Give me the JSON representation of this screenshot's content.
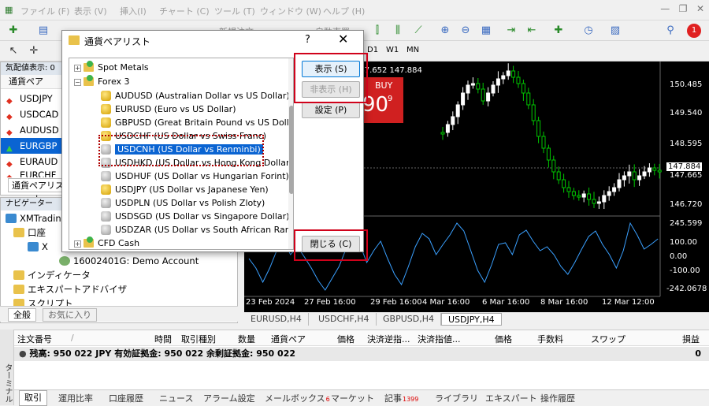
{
  "menu": [
    "ファイル (F)",
    "表示 (V)",
    "挿入(I)",
    "チャート (C)",
    "ツール (T)",
    "ウィンドウ (W)",
    "ヘルプ (H)"
  ],
  "toolbar": {
    "new_order": "新規注文",
    "auto_trade": "自動売買"
  },
  "timeframes": [
    "D1",
    "W1",
    "MN"
  ],
  "quote_line": "147.652 147.884",
  "buy": {
    "label": "BUY",
    "price": "90",
    "sup": "9"
  },
  "market_watch": {
    "header": "気配値表示: 0",
    "column": "通貨ペア",
    "tab": "通貨ペアリスト",
    "rows": [
      {
        "symbol": "USDJPY",
        "dir": "down"
      },
      {
        "symbol": "USDCAD",
        "dir": "down"
      },
      {
        "symbol": "AUDUSD",
        "dir": "down"
      },
      {
        "symbol": "EURGBP",
        "dir": "up"
      },
      {
        "symbol": "EURAUD",
        "dir": "down"
      },
      {
        "symbol": "EURCHF",
        "dir": "down"
      }
    ]
  },
  "navigator": {
    "header": "ナビゲーター",
    "root": "XMTradin",
    "account_folder": "口座",
    "account_sub": "X",
    "demo_account": "16002401G: Demo Account",
    "items": [
      "インディケータ",
      "エキスパートアドバイザ",
      "スクリプト"
    ],
    "tabs": [
      "全般",
      "お気に入り"
    ]
  },
  "dialog": {
    "title": "通貨ペアリスト",
    "help": "?",
    "close": "✕",
    "buttons": {
      "show": "表示 (S)",
      "hide": "非表示 (H)",
      "settings": "設定 (P)",
      "close": "閉じる (C)"
    },
    "tree": {
      "groups": [
        "Spot Metals",
        "Forex 3",
        "CFD Cash"
      ],
      "items": [
        {
          "text": "AUDUSD  (Australian Dollar vs US Dollar)",
          "icon": "gold"
        },
        {
          "text": "EURUSD  (Euro vs US Dollar)",
          "icon": "gold"
        },
        {
          "text": "GBPUSD  (Great Britain Pound vs US Dollar)",
          "icon": "gold"
        },
        {
          "text": "USDCHF  (US Dollar vs Swiss Franc)",
          "icon": "gold"
        },
        {
          "text": "USDCNH  (US Dollar vs Renminbi)",
          "icon": "grey",
          "selected": true
        },
        {
          "text": "USDHKD  (US Dollar vs Hong Kong Dollar)",
          "icon": "grey"
        },
        {
          "text": "USDHUF  (US Dollar vs Hungarian Forint)",
          "icon": "grey"
        },
        {
          "text": "USDJPY  (US Dollar vs Japanese Yen)",
          "icon": "gold"
        },
        {
          "text": "USDPLN  (US Dollar vs Polish Zloty)",
          "icon": "grey"
        },
        {
          "text": "USDSGD  (US Dollar vs Singapore Dollar)",
          "icon": "grey"
        },
        {
          "text": "USDZAR  (US Dollar vs South African Rand)",
          "icon": "grey"
        }
      ]
    }
  },
  "chart_data": {
    "type": "candlestick",
    "price_axis": [
      "150.485",
      "149.540",
      "148.595",
      "147.884",
      "147.665",
      "146.720"
    ],
    "current_price": "147.884",
    "indicator_axis": [
      "245.599",
      "100.00",
      "0.00",
      "-100.00",
      "-242.0678"
    ],
    "time_axis": [
      "23 Feb 2024",
      "27 Feb 16:00",
      "29 Feb 16:00",
      "4 Mar 16:00",
      "6 Mar 16:00",
      "8 Mar 16:00",
      "12 Mar 12:00"
    ],
    "up_color": "#ffffff",
    "down_color": "#00c800",
    "indicator_color": "#3aa0ff"
  },
  "chart_tabs": [
    "EURUSD,H4",
    "USDCHF,H4",
    "GBPUSD,H4",
    "USDJPY,H4"
  ],
  "terminal": {
    "side_label": "ターミナル",
    "columns": [
      "注文番号",
      "/",
      "時間",
      "取引種別",
      "数量",
      "通貨ペア",
      "価格",
      "決済逆指...",
      "決済指値...",
      "価格",
      "手数料",
      "スワップ",
      "損益"
    ],
    "balance": "残高: 950 022 JPY  有効証拠金: 950 022  余剰証拠金: 950 022",
    "balance_pl": "0",
    "tabs": [
      {
        "label": "取引"
      },
      {
        "label": "運用比率"
      },
      {
        "label": "口座履歴"
      },
      {
        "label": "ニュース"
      },
      {
        "label": "アラーム設定"
      },
      {
        "label": "メールボックス",
        "badge": "6"
      },
      {
        "label": "マーケット"
      },
      {
        "label": "記事",
        "badge": "1399"
      },
      {
        "label": "ライブラリ"
      },
      {
        "label": "エキスパート"
      },
      {
        "label": "操作履歴"
      }
    ]
  },
  "notifications": "1"
}
